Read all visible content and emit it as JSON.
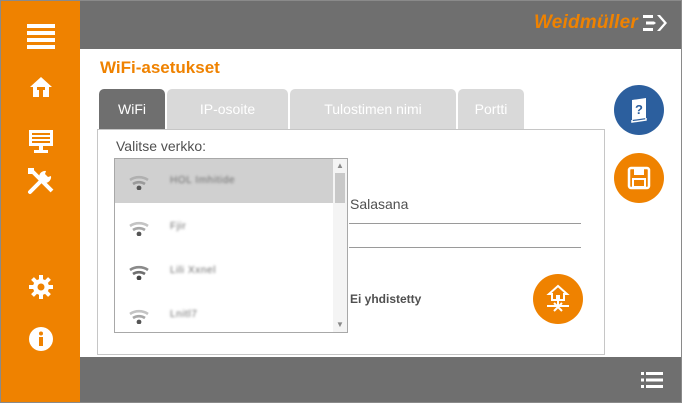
{
  "app": {
    "brand": "Weidmüller",
    "colors": {
      "accent": "#ef8200",
      "bar": "#6f6f6f",
      "help": "#2c5f9e"
    }
  },
  "sidebar": {
    "items": [
      {
        "icon": "menu-icon"
      },
      {
        "icon": "home-icon"
      },
      {
        "icon": "monitor-icon"
      },
      {
        "icon": "tools-icon"
      },
      {
        "icon": "gear-icon"
      },
      {
        "icon": "info-icon"
      }
    ]
  },
  "page": {
    "title": "WiFi-asetukset"
  },
  "tabs": [
    {
      "label": "WiFi",
      "active": true
    },
    {
      "label": "IP-osoite",
      "active": false
    },
    {
      "label": "Tulostimen nimi",
      "active": false
    },
    {
      "label": "Portti",
      "active": false
    }
  ],
  "wifi": {
    "select_label": "Valitse verkko:",
    "networks": [
      {
        "name": "HOL Imhitide",
        "selected": true
      },
      {
        "name": "Fjir",
        "selected": false
      },
      {
        "name": "Lili Xxnel",
        "selected": false
      },
      {
        "name": "Lnitl7",
        "selected": false
      }
    ],
    "password_label": "Salasana",
    "password_value": "",
    "status": "Ei yhdistetty"
  },
  "actions": {
    "help_icon": "help-book-icon",
    "save_icon": "save-icon",
    "connect_icon": "network-connect-icon"
  },
  "bottombar": {
    "icon": "list-menu-icon"
  }
}
